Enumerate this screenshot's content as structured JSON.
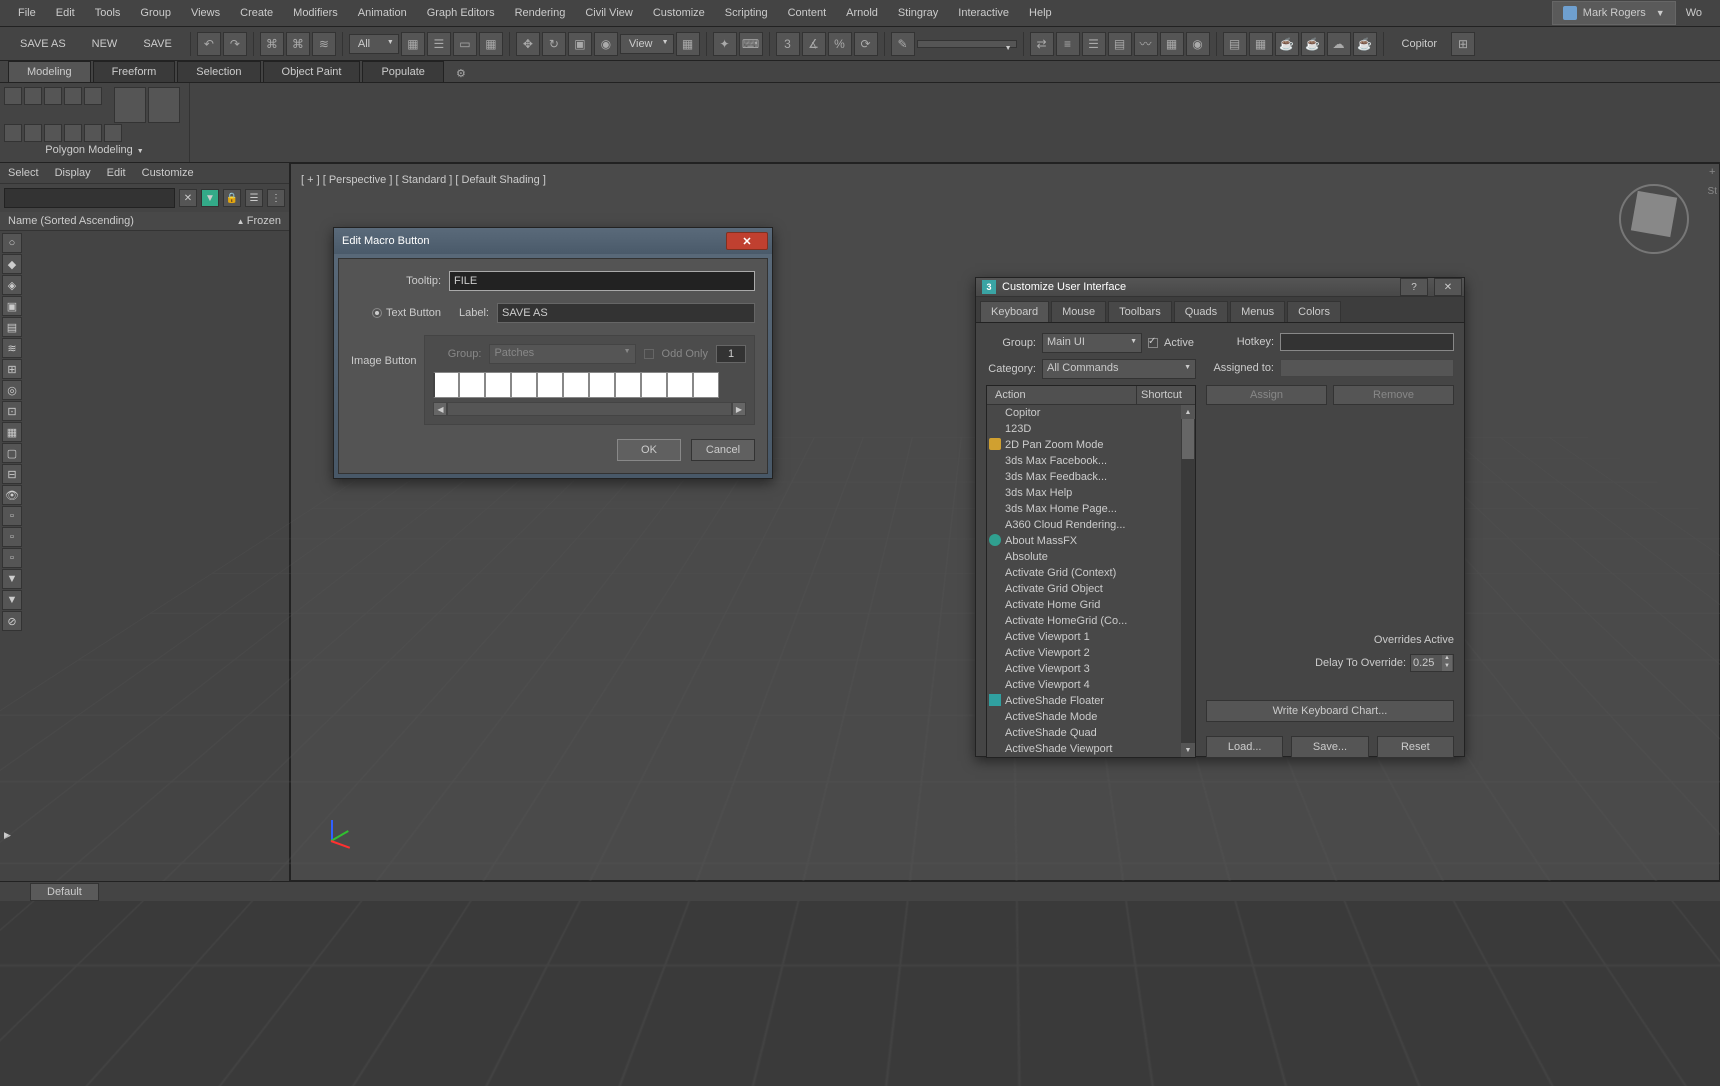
{
  "menubar": [
    "File",
    "Edit",
    "Tools",
    "Group",
    "Views",
    "Create",
    "Modifiers",
    "Animation",
    "Graph Editors",
    "Rendering",
    "Civil View",
    "Customize",
    "Scripting",
    "Content",
    "Arnold",
    "Stingray",
    "Interactive",
    "Help"
  ],
  "user": {
    "name": "Mark Rogers",
    "right_label": "Wo"
  },
  "quickaccess": {
    "save_as": "SAVE AS",
    "new": "NEW",
    "save": "SAVE"
  },
  "toolbar": {
    "filter": "All",
    "refsys": "View",
    "copitor": "Copitor"
  },
  "ribbon_tabs": [
    "Modeling",
    "Freeform",
    "Selection",
    "Object Paint",
    "Populate"
  ],
  "ribbon_active": "Modeling",
  "ribbon_panel_name": "Polygon Modeling",
  "scene_panel": {
    "tabs": [
      "Select",
      "Display",
      "Edit",
      "Customize"
    ],
    "header_col1": "Name (Sorted Ascending)",
    "header_col2": "Frozen"
  },
  "viewport_label": "[ + ] [ Perspective ] [ Standard ] [ Default Shading ]",
  "right_sidebar_label": "St",
  "macro_dialog": {
    "title": "Edit Macro Button",
    "tooltip_label": "Tooltip:",
    "tooltip_value": "FILE",
    "text_button": "Text Button",
    "image_button": "Image Button",
    "label_label": "Label:",
    "label_value": "SAVE AS",
    "group_label": "Group:",
    "group_value": "Patches",
    "odd_only": "Odd Only",
    "number": "1",
    "ok": "OK",
    "cancel": "Cancel"
  },
  "cui_dialog": {
    "title": "Customize User Interface",
    "tabs": [
      "Keyboard",
      "Mouse",
      "Toolbars",
      "Quads",
      "Menus",
      "Colors"
    ],
    "active_tab": "Keyboard",
    "group_label": "Group:",
    "group_value": "Main UI",
    "active_chk": "Active",
    "category_label": "Category:",
    "category_value": "All Commands",
    "col_action": "Action",
    "col_shortcut": "Shortcut",
    "actions": [
      "Copitor",
      "123D",
      "2D Pan Zoom Mode",
      "3ds Max Facebook...",
      "3ds Max Feedback...",
      "3ds Max Help",
      "3ds Max Home Page...",
      "A360 Cloud Rendering...",
      "About MassFX",
      "Absolute",
      "Activate Grid (Context)",
      "Activate Grid Object",
      "Activate Home Grid",
      "Activate HomeGrid (Co...",
      "Active Viewport 1",
      "Active Viewport 2",
      "Active Viewport 3",
      "Active Viewport 4",
      "ActiveShade Floater",
      "ActiveShade Mode",
      "ActiveShade Quad",
      "ActiveShade Viewport"
    ],
    "action_icons": {
      "2": "key",
      "8": "info",
      "18": "cube"
    },
    "hotkey_label": "Hotkey:",
    "assigned_label": "Assigned to:",
    "assign": "Assign",
    "remove": "Remove",
    "overrides_active": "Overrides Active",
    "delay_label": "Delay To Override:",
    "delay_value": "0.25",
    "write_chart": "Write Keyboard Chart...",
    "load": "Load...",
    "save": "Save...",
    "reset": "Reset"
  },
  "statusbar": {
    "default": "Default"
  }
}
